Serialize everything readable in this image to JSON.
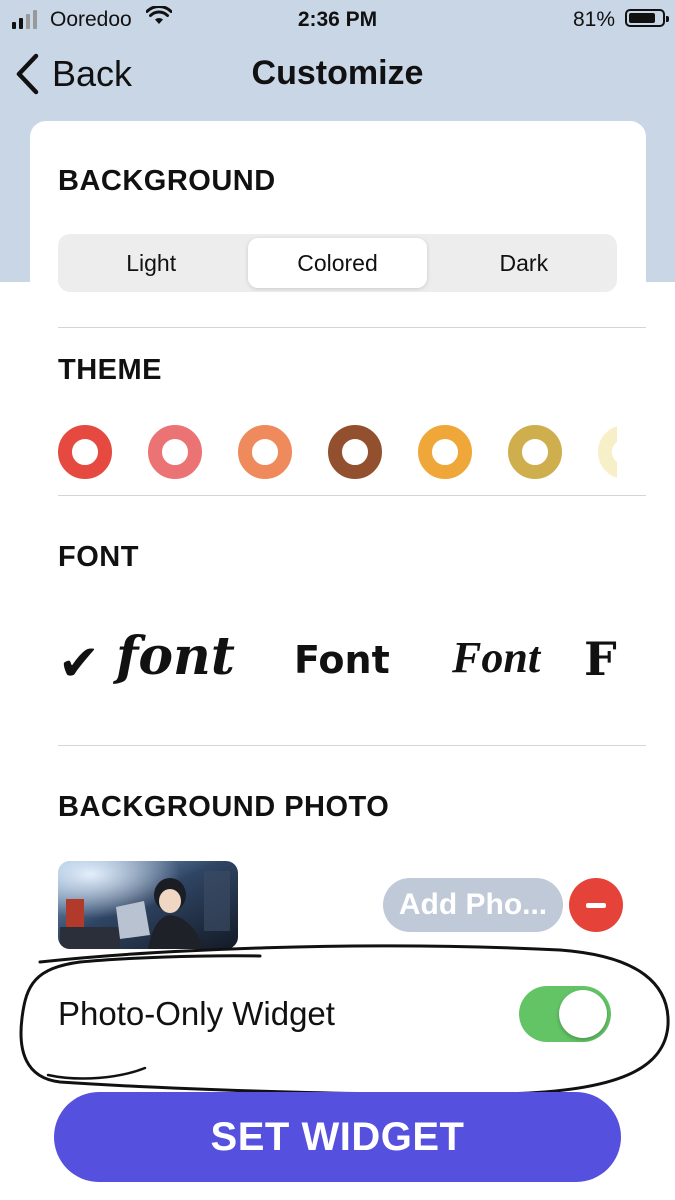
{
  "status_bar": {
    "carrier": "Ooredoo",
    "time": "2:36 PM",
    "battery_percent": "81%",
    "battery_level": 0.81,
    "signal_icon": "signal-bars-icon",
    "wifi_icon": "wifi-icon"
  },
  "nav": {
    "back_label": "Back",
    "title": "Customize",
    "back_icon": "chevron-left-icon"
  },
  "background": {
    "title": "BACKGROUND",
    "options": [
      "Light",
      "Colored",
      "Dark"
    ],
    "selected": "Colored"
  },
  "theme": {
    "title": "THEME",
    "colors": [
      "#e5493f",
      "#ec7373",
      "#ee8a5c",
      "#93502e",
      "#efa73a",
      "#cfae4e",
      "#f6efc8"
    ]
  },
  "font": {
    "title": "FONT",
    "selected_icon": "checkmark-icon",
    "check_glyph": "✔",
    "options": [
      "font",
      "Font",
      "Font",
      "F"
    ]
  },
  "background_photo": {
    "title": "BACKGROUND PHOTO",
    "add_label": "Add Pho...",
    "remove_icon": "minus-circle-icon",
    "thumbnail_icon": "photo-thumbnail"
  },
  "photo_only_widget": {
    "label": "Photo-Only Widget",
    "enabled": true
  },
  "set_widget_label": "SET WIDGET",
  "colors": {
    "accent": "#5550de",
    "toggle_on": "#63c466",
    "remove": "#e5423a",
    "header_bg": "#c9d6e6"
  }
}
